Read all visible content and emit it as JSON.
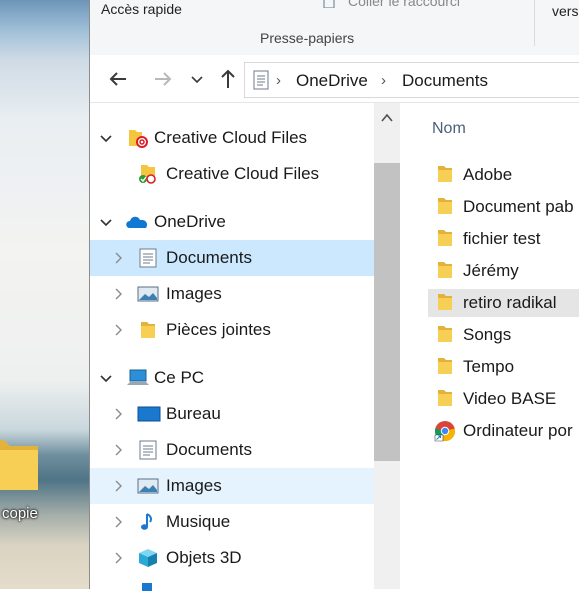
{
  "ribbon": {
    "quick_access": "Accès rapide",
    "paste_shortcut": "Coller le raccourci",
    "version": "vers",
    "clipboard_group": "Presse-papiers"
  },
  "address": {
    "crumbs": [
      "OneDrive",
      "Documents"
    ]
  },
  "nav": {
    "items": [
      {
        "label": "Creative Cloud Files",
        "icon": "creative-cloud-folder-icon"
      },
      {
        "label": "Creative Cloud Files",
        "icon": "creative-cloud-sync-folder-icon"
      },
      {
        "label": "OneDrive",
        "icon": "onedrive-cloud-icon"
      },
      {
        "label": "Documents",
        "icon": "document-icon",
        "selected": true
      },
      {
        "label": "Images",
        "icon": "pictures-icon"
      },
      {
        "label": "Pièces jointes",
        "icon": "folder-icon"
      },
      {
        "label": "Ce PC",
        "icon": "computer-icon"
      },
      {
        "label": "Bureau",
        "icon": "desktop-icon"
      },
      {
        "label": "Documents",
        "icon": "document-icon"
      },
      {
        "label": "Images",
        "icon": "pictures-icon",
        "hover": true
      },
      {
        "label": "Musique",
        "icon": "music-note-icon"
      },
      {
        "label": "Objets 3D",
        "icon": "cube-3d-icon"
      }
    ]
  },
  "filelist": {
    "column_name": "Nom",
    "items": [
      {
        "label": "Adobe",
        "icon": "folder-icon"
      },
      {
        "label": "Document pab",
        "icon": "folder-icon"
      },
      {
        "label": "fichier test",
        "icon": "folder-icon"
      },
      {
        "label": "Jérémy",
        "icon": "folder-icon"
      },
      {
        "label": "retiro radikal",
        "icon": "folder-icon",
        "hover": true
      },
      {
        "label": "Songs",
        "icon": "folder-icon"
      },
      {
        "label": "Tempo",
        "icon": "folder-icon"
      },
      {
        "label": "Video BASE",
        "icon": "folder-icon"
      },
      {
        "label": "Ordinateur por",
        "icon": "chrome-shortcut-icon"
      }
    ]
  },
  "desktop": {
    "label": "copie"
  },
  "colors": {
    "selected": "#cce8ff",
    "hover_nav": "#e5f3ff",
    "hover_file": "#e5e5e5",
    "folder": "#f4c53f",
    "header_text": "#4c607a"
  }
}
